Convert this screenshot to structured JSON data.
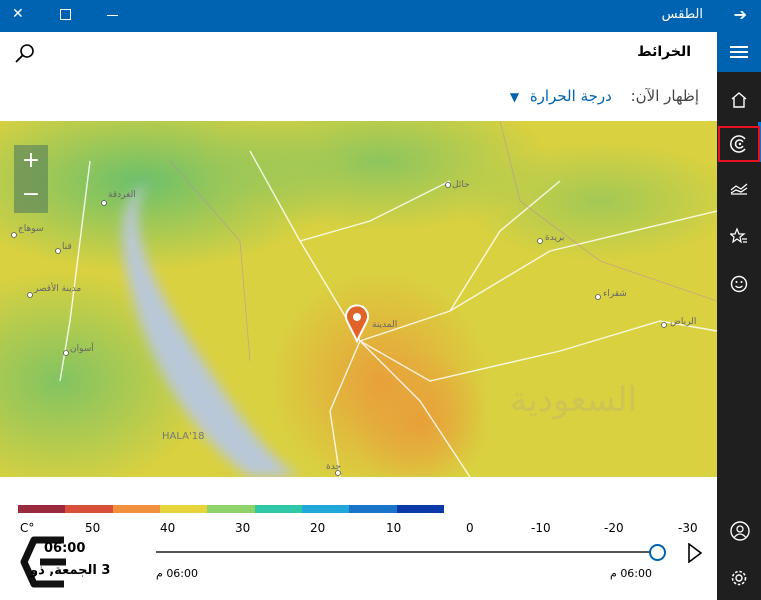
{
  "window": {
    "title": "الطقس"
  },
  "header": {
    "title": "الخرائط"
  },
  "show_now": {
    "label": "إظهار الآن:",
    "selected": "درجة الحرارة"
  },
  "map": {
    "labels": [
      "الغردقة",
      "سوهاج",
      "قنا",
      "مدينة الأقصر",
      "أسوان",
      "حائل",
      "بريدة",
      "شقراء",
      "الرياض",
      "المدينة",
      "جدة",
      "HALA'18",
      "السعودية"
    ],
    "zoom_in": "+",
    "zoom_out": "−"
  },
  "legend": {
    "colors": [
      "#9b2a3f",
      "#d94f3c",
      "#f0903d",
      "#e7d43b",
      "#8ed36a",
      "#2fc7a6",
      "#1fa8d9",
      "#1a74c9",
      "#0b39a8"
    ],
    "labels": [
      "C°",
      "50",
      "40",
      "30",
      "20",
      "10",
      "0",
      "-10",
      "-20",
      "-30"
    ]
  },
  "timeline": {
    "time": "06:00",
    "date": "الجمعة, ذو",
    "prefix": "3",
    "start_tick": "06:00 م",
    "end_tick": "06:00 م"
  },
  "nav": [
    "home-icon",
    "radar-icon",
    "historical-icon",
    "news-icon",
    "smiley-icon",
    "account-icon",
    "settings-icon"
  ]
}
